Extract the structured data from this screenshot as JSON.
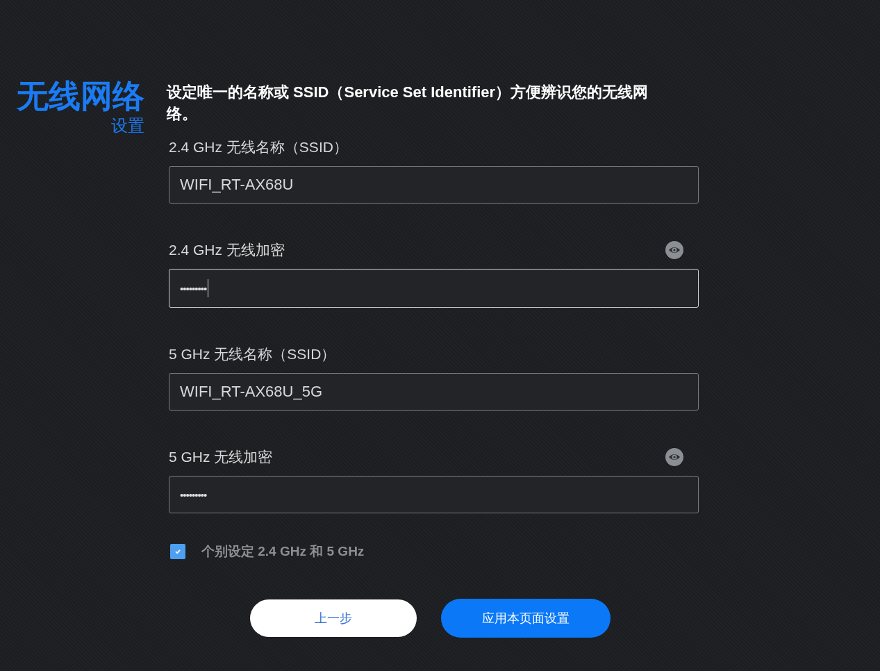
{
  "title": {
    "main": "无线网络",
    "sub": "设置"
  },
  "description": "设定唯一的名称或 SSID（Service Set Identifier）方便辨识您的无线网络。",
  "fields": [
    {
      "kind": "text",
      "label": "2.4 GHz 无线名称（SSID）",
      "value": "WIFI_RT-AX68U",
      "focused": false
    },
    {
      "kind": "password",
      "label": "2.4 GHz 无线加密",
      "value": "•••••••••",
      "focused": true
    },
    {
      "kind": "text",
      "label": "5 GHz 无线名称（SSID）",
      "value": "WIFI_RT-AX68U_5G",
      "focused": false
    },
    {
      "kind": "password",
      "label": "5 GHz 无线加密",
      "value": "•••••••••",
      "focused": false
    }
  ],
  "separate_bands": {
    "label": "个别设定 2.4 GHz 和 5 GHz",
    "checked": true
  },
  "buttons": [
    {
      "kind": "secondary",
      "label": "上一步"
    },
    {
      "kind": "primary",
      "label": "应用本页面设置"
    }
  ]
}
